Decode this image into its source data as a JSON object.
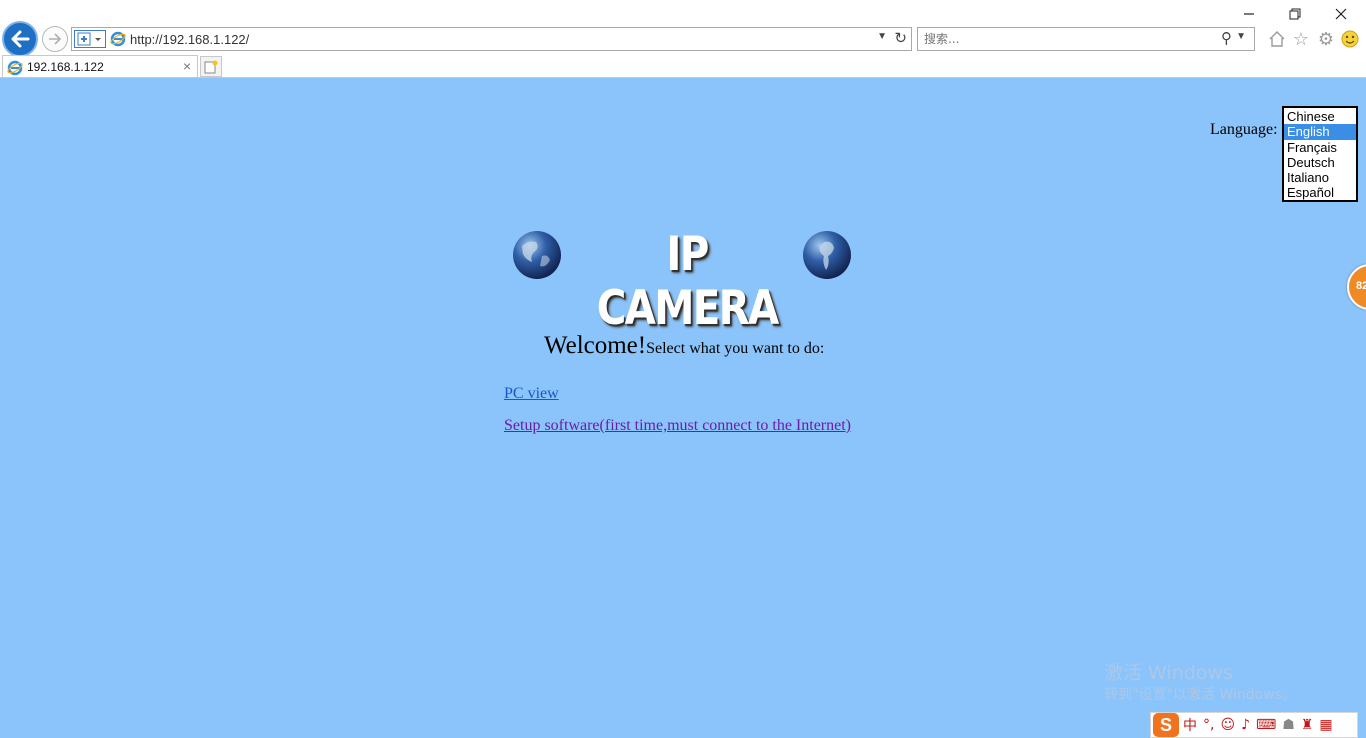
{
  "window": {
    "minimize_icon": "minimize-icon",
    "maximize_icon": "restore-icon",
    "close_icon": "close-icon"
  },
  "toolbar": {
    "url": "http://192.168.1.122/",
    "search_placeholder": "搜索...",
    "icons": [
      "back-arrow-icon",
      "forward-arrow-icon",
      "compat-view-icon",
      "refresh-icon",
      "search-icon",
      "home-icon",
      "star-icon",
      "gear-icon",
      "smiley-icon"
    ]
  },
  "tab": {
    "title": "192.168.1.122",
    "close": "×"
  },
  "page": {
    "language_label": "Language:",
    "languages": [
      "Chinese",
      "English",
      "Français",
      "Deutsch",
      "Italiano",
      "Español"
    ],
    "selected_language": "English",
    "logo_text": "IP CAMERA",
    "welcome_big": "Welcome!",
    "welcome_small": "Select what you want to do:",
    "link_pc_view": "PC view",
    "link_setup": "Setup software(first time,must connect to the Internet)",
    "side_badge": "82",
    "watermark_line1": "激活 Windows",
    "watermark_line2": "转到\"设置\"以激活 Windows。"
  },
  "ime": {
    "logo": "S",
    "mode": "中",
    "punct": "°,",
    "icons": [
      "emoji-icon",
      "microphone-icon",
      "keyboard-icon",
      "user-icon",
      "shirt-icon",
      "grid-icon"
    ]
  },
  "colors": {
    "page_bg": "#8bc4fa",
    "back_button": "#1f6fc4",
    "link_visited": "#6b1ca8",
    "link": "#1a56c9",
    "selected_option": "#3a8ee6"
  }
}
